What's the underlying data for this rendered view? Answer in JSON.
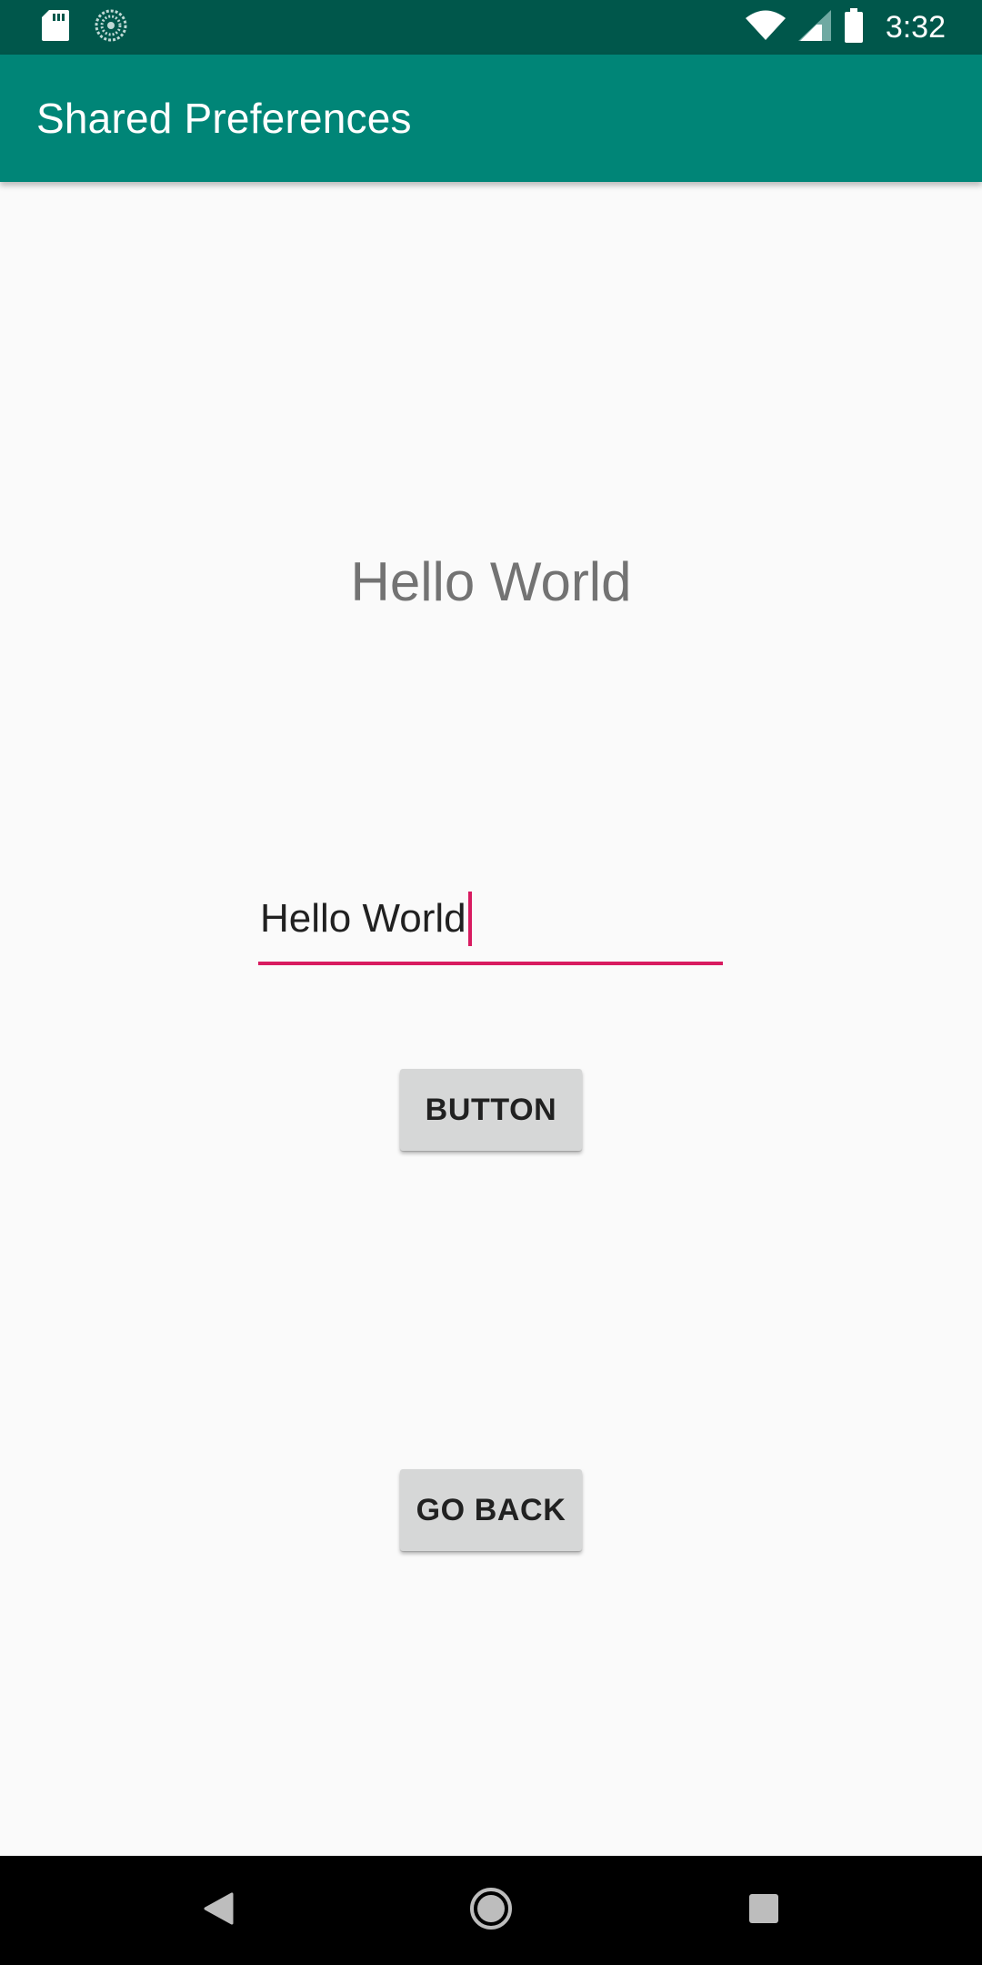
{
  "status_bar": {
    "time": "3:32",
    "left_icons": [
      "sd-card-icon",
      "sync-icon"
    ],
    "right_icons": [
      "wifi-icon",
      "cellular-signal-icon",
      "battery-icon"
    ]
  },
  "app_bar": {
    "title": "Shared Preferences"
  },
  "main": {
    "display_text": "Hello World",
    "input_value": "Hello World",
    "button_label": "BUTTON",
    "go_back_label": "GO BACK"
  },
  "nav_bar": {
    "icons": [
      "back-icon",
      "home-icon",
      "recents-icon"
    ]
  },
  "colors": {
    "status_bar": "#00574B",
    "app_bar": "#008577",
    "accent": "#D81B60",
    "background": "#FAFAFA",
    "button": "#D6D7D7"
  }
}
